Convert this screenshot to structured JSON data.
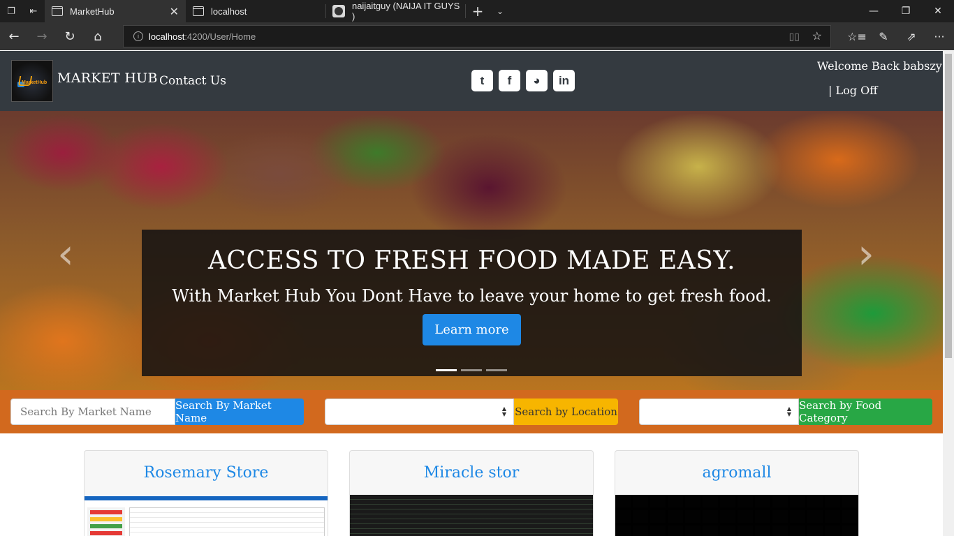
{
  "browser": {
    "tabs": [
      {
        "title": "MarketHub",
        "active": true
      },
      {
        "title": "localhost",
        "active": false
      },
      {
        "title": "naijaitguy (NAIJA IT GUYS )",
        "active": false
      }
    ],
    "url_host": "localhost",
    "url_path": ":4200/User/Home"
  },
  "navbar": {
    "logo_text": "MarketHub",
    "brand": "MARKET HUB",
    "contact": "Contact Us",
    "socials": [
      {
        "name": "twitter-icon",
        "glyph": "t"
      },
      {
        "name": "facebook-icon",
        "glyph": "f"
      },
      {
        "name": "github-icon",
        "glyph": "◕"
      },
      {
        "name": "linkedin-icon",
        "glyph": "in"
      }
    ],
    "welcome": "Welcome Back babszy",
    "logoff": "| Log Off"
  },
  "carousel": {
    "heading": "ACCESS TO FRESH FOOD MADE EASY.",
    "subheading": "With Market Hub You Dont Have to leave your home to get fresh food.",
    "button": "Learn more",
    "active_slide": 1,
    "slide_count": 3
  },
  "search": {
    "market_placeholder": "Search By Market Name",
    "market_button": "Search By Market Name",
    "location_value": "",
    "location_button": "Search by Location",
    "category_value": "",
    "category_button": "Search by Food Category"
  },
  "stores": [
    {
      "name": "Rosemary Store"
    },
    {
      "name": "Miracle stor"
    },
    {
      "name": "agromall"
    }
  ],
  "colors": {
    "navbar": "#343a40",
    "search_bar": "#d2691e",
    "primary": "#1e88e5",
    "warning": "#f7b500",
    "success": "#28a745"
  }
}
